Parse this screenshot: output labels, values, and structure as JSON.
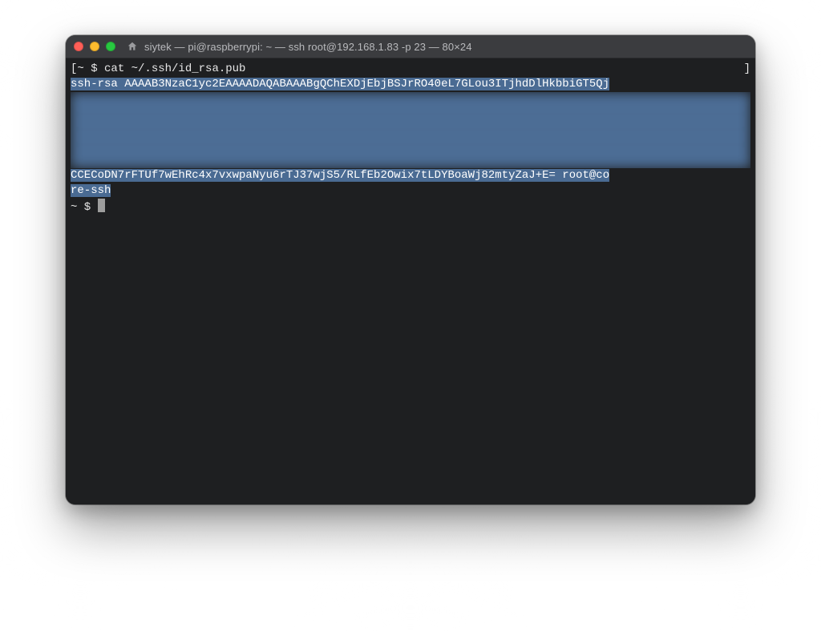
{
  "window": {
    "title": "siytek — pi@raspberrypi: ~ — ssh root@192.168.1.83 -p 23 — 80×24"
  },
  "terminal": {
    "bracket_left": "[",
    "bracket_right": "]",
    "prompt_prefix": "~ $ ",
    "command": "cat ~/.ssh/id_rsa.pub",
    "key_line1": "ssh-rsa AAAAB3NzaC1yc2EAAAADAQABAAABgQChEXDjEbjBSJrRO40eL7GLou3ITjhdDlHkbbiGT5Qj",
    "key_line_tail1": "CCECoDN7rFTUf7wEhRc4x7vxwpaNyu6rTJ37wjS5/RLfEb2Owix7tLDYBoaWj82mtyZaJ+E= root@co",
    "key_line_tail2": "re-ssh",
    "prompt2": "~ $ "
  },
  "colors": {
    "titlebar_bg": "#3b3c3f",
    "terminal_bg": "#1e1f21",
    "selection_bg": "#4a6b93",
    "text": "#e6e6e6"
  }
}
